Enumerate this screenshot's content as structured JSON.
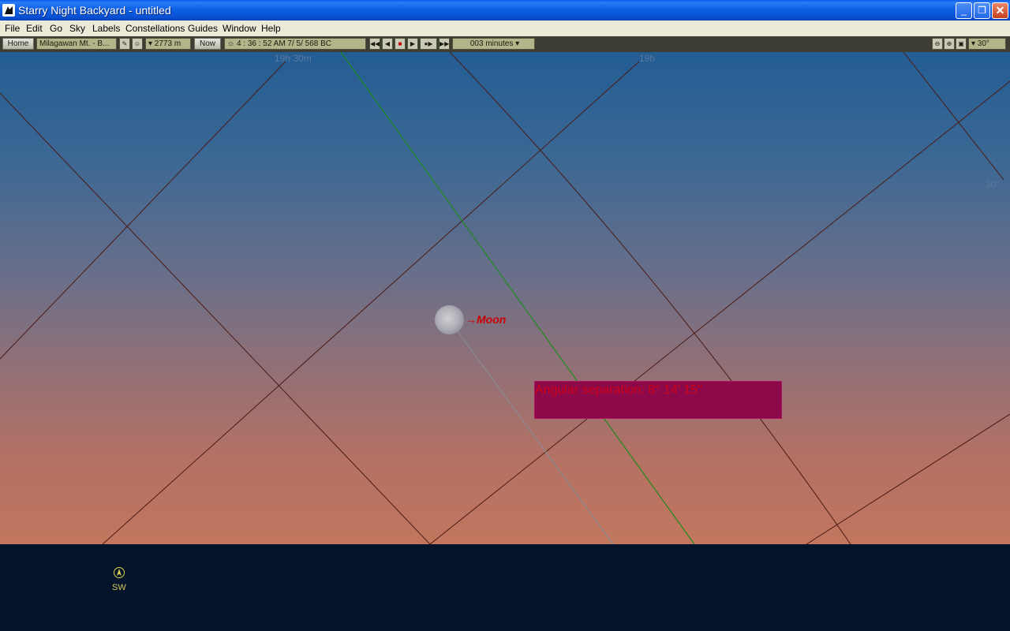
{
  "window": {
    "title": "Starry Night Backyard - untitled",
    "minimize": "_",
    "restore": "❐",
    "close": "✕"
  },
  "menu": [
    "File",
    "Edit",
    "Go",
    "Sky",
    "Labels",
    "Constellations",
    "Guides",
    "Window",
    "Help"
  ],
  "toolbar": {
    "home": "Home",
    "location": "Milagawan Mt. - B...",
    "elevation": "▾ 2773 m",
    "now": "Now",
    "time": "4 : 36 : 52 AM     7/   5/   568 BC",
    "step": "003 minutes ▾",
    "fov": "▾ 30°"
  },
  "sky": {
    "grid_labels": {
      "ra_1930": "19h 30m",
      "ra_19": "19h",
      "dec": "-30°"
    },
    "moon_label": "→Moon",
    "angular_separation": "Angular separation: 8° 14' 15\""
  },
  "horizon": {
    "direction": "SW"
  },
  "colors": {
    "moon_label": "#cc0000",
    "separation_box": "#8c0a4a",
    "ecliptic": "#1e8a1e",
    "grid": "#4a1a14"
  }
}
